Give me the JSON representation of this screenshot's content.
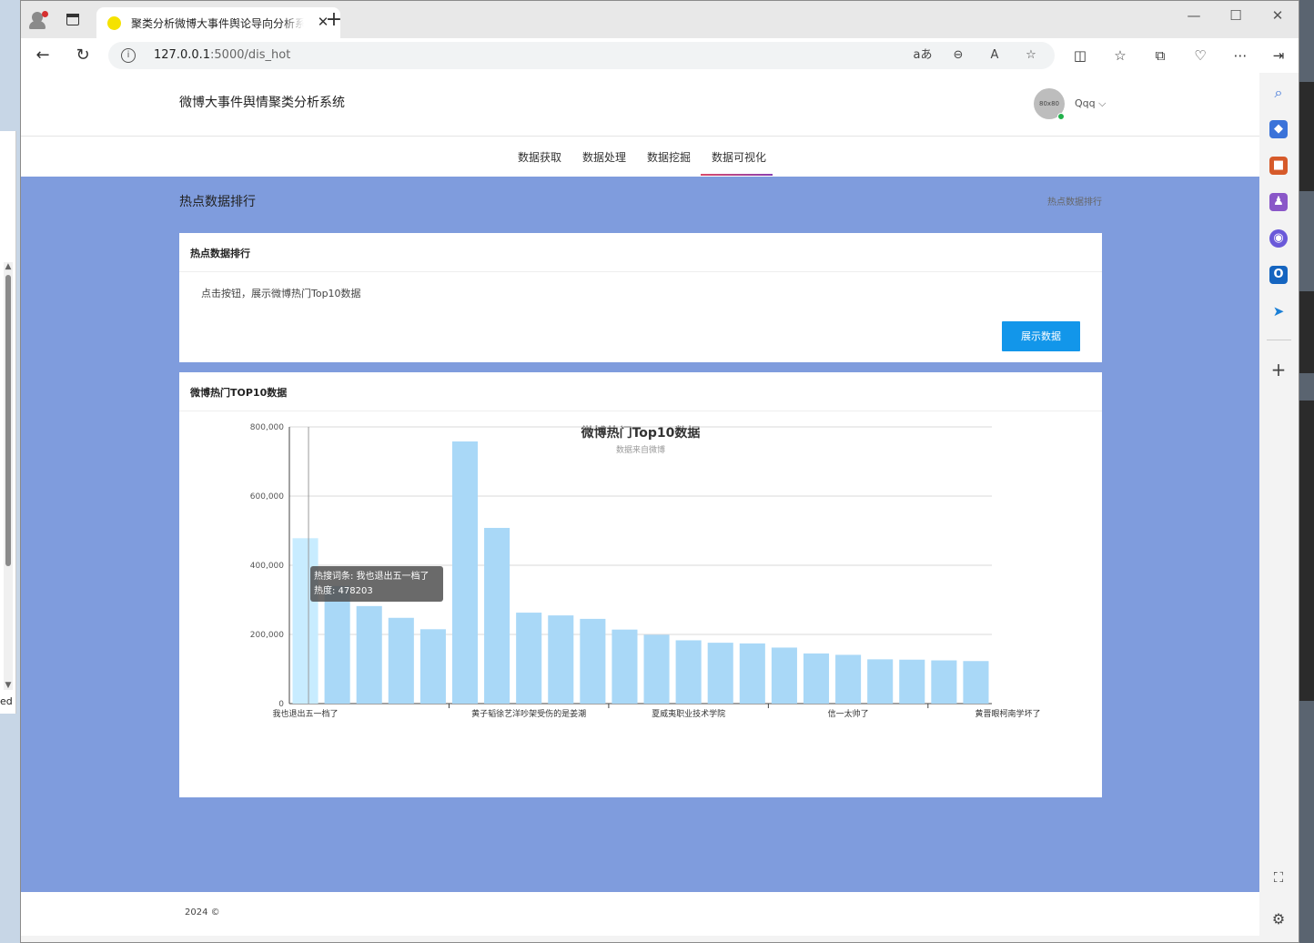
{
  "browser": {
    "tab_title": "聚类分析微博大事件舆论导向分析系统",
    "url_host": "127.0.0.1",
    "url_path": ":5000/dis_hot",
    "tab_close": "✕",
    "new_tab": "+",
    "window_controls": [
      "—",
      "☐",
      "✕"
    ],
    "nav": {
      "back": "←",
      "refresh": "↻",
      "info": "i"
    },
    "addr_icons": [
      "aあ",
      "⊖",
      "A",
      "☆"
    ],
    "tool_icons": [
      "◫",
      "☆",
      "⧉",
      "♡",
      "⋯",
      "⇥"
    ],
    "sidebar_icons": [
      {
        "name": "search",
        "glyph": "⌕",
        "color": "#3b73d9"
      },
      {
        "name": "tag",
        "glyph": "◆",
        "color": "#3b73d9"
      },
      {
        "name": "toolbox",
        "glyph": "■",
        "color": "#d65a2a"
      },
      {
        "name": "people",
        "glyph": "♟",
        "color": "#8a57c8"
      },
      {
        "name": "copilot",
        "glyph": "◉",
        "color": "#6a59d9"
      },
      {
        "name": "outlook",
        "glyph": "O",
        "color": "#1565c0"
      },
      {
        "name": "send",
        "glyph": "➤",
        "color": "#1a7fd6"
      },
      {
        "name": "add",
        "glyph": "+",
        "color": "#444"
      },
      {
        "name": "screenshot",
        "glyph": "⛶",
        "color": "#444"
      },
      {
        "name": "settings",
        "glyph": "⚙",
        "color": "#444"
      }
    ]
  },
  "desktop": {
    "left_text": "ed"
  },
  "site": {
    "brand": "微博大事件舆情聚类分析系统",
    "avatar_text": "80x80",
    "user": "Qqq ⌵",
    "nav": [
      "数据获取",
      "数据处理",
      "数据挖掘",
      "数据可视化"
    ],
    "active_nav": "数据可视化"
  },
  "main": {
    "title": "热点数据排行",
    "breadcrumb": "热点数据排行",
    "card1": {
      "header": "热点数据排行",
      "desc": "点击按钮，展示微博热门Top10数据",
      "button": "展示数据"
    },
    "card2": {
      "header": "微博热门TOP10数据"
    },
    "tooltip": {
      "line1": "热搜词条: 我也退出五一档了",
      "line2": "热度: 478203"
    }
  },
  "footer": {
    "copyright": "2024 ©"
  },
  "chart_data": {
    "type": "bar",
    "title": "微博热门Top10数据",
    "subtitle": "数据来自微博",
    "ylim": [
      0,
      800000
    ],
    "yticks": [
      0,
      200000,
      400000,
      600000,
      800000
    ],
    "ytick_labels": [
      "0",
      "200,000",
      "400,000",
      "600,000",
      "800,000"
    ],
    "x_tick_labels": [
      {
        "index": 0,
        "label": "我也退出五一档了"
      },
      {
        "index": 5,
        "label": "黄子韬徐艺洋吵架受伤的是姜潮"
      },
      {
        "index": 10,
        "label": "夏威夷职业技术学院"
      },
      {
        "index": 15,
        "label": "信一太帅了"
      },
      {
        "index": 20,
        "label": "黄晋眼柯南学坏了"
      }
    ],
    "values": [
      478203,
      340000,
      282000,
      248000,
      215000,
      758000,
      508000,
      263000,
      255000,
      245000,
      214000,
      199000,
      183000,
      176000,
      174000,
      162000,
      145000,
      141000,
      128000,
      127000,
      125000,
      123000
    ],
    "highlight_index": 0,
    "bar_color": "#a9d8f7",
    "highlight_color": "#c8ecff",
    "grid": true
  }
}
